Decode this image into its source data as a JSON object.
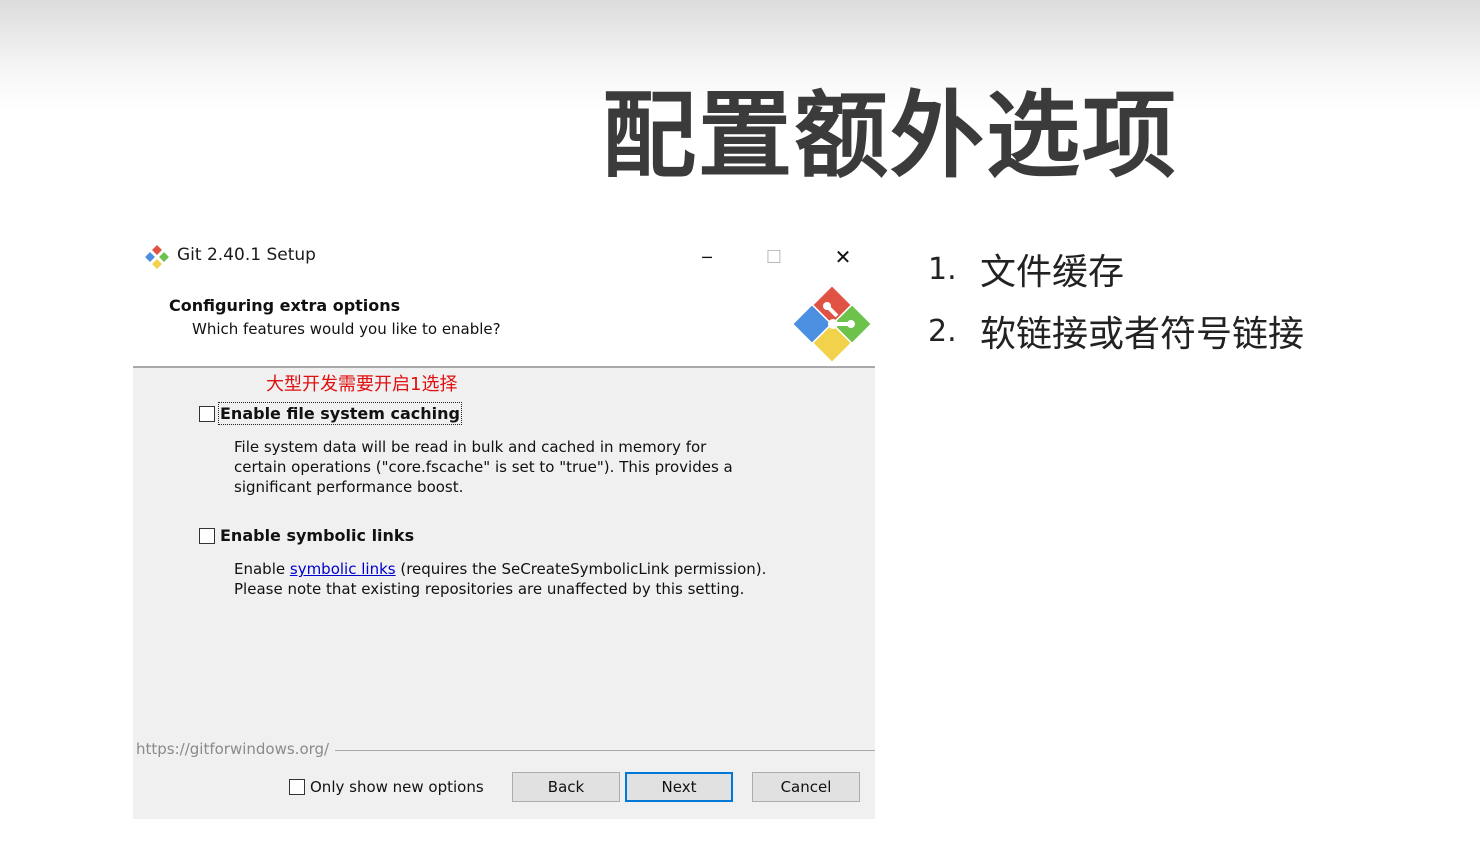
{
  "slide": {
    "title": "配置额外选项",
    "notes": [
      {
        "num": "1.",
        "text": "文件缓存"
      },
      {
        "num": "2.",
        "text": "软链接或者符号链接"
      }
    ]
  },
  "window": {
    "title": "Git 2.40.1 Setup",
    "minimize_glyph": "─",
    "maximize_glyph": "☐",
    "close_glyph": "✕"
  },
  "header": {
    "title": "Configuring extra options",
    "subtitle": "Which features would you like to enable?"
  },
  "annotation": "大型开发需要开启1选择",
  "options": [
    {
      "label": "Enable file system caching",
      "checked": false,
      "description": "File system data will be read in bulk and cached in memory for certain operations (\"core.fscache\" is set to \"true\"). This provides a significant performance boost."
    },
    {
      "label": "Enable symbolic links",
      "checked": false,
      "description_prefix": "Enable ",
      "description_link": "symbolic links",
      "description_suffix": " (requires the SeCreateSymbolicLink permission).",
      "description_line2": "Please note that existing repositories are unaffected by this setting."
    }
  ],
  "footer": {
    "url": "https://gitforwindows.org/",
    "only_new_label": "Only show new options",
    "only_new_checked": false,
    "back_label": "Back",
    "next_label": "Next",
    "cancel_label": "Cancel"
  }
}
